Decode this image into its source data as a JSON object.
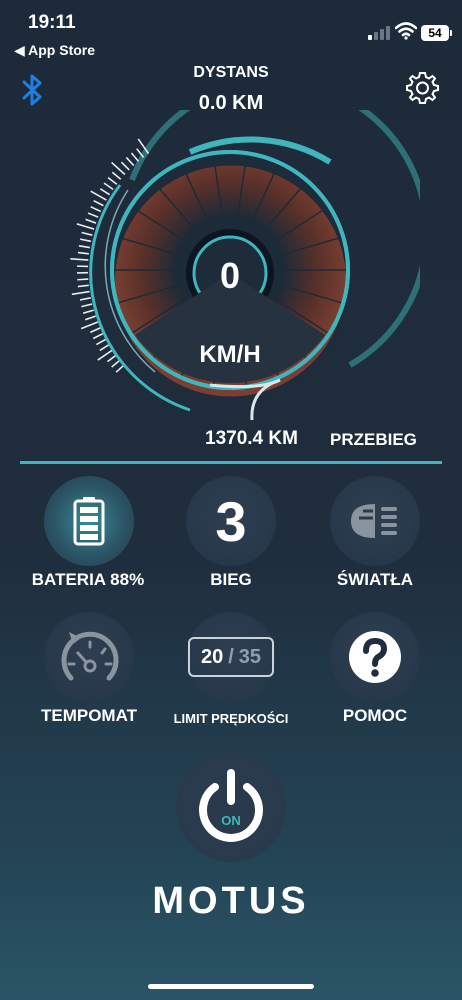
{
  "status_bar": {
    "time": "19:11",
    "back_label": "◀ App Store",
    "battery": "54"
  },
  "header": {
    "distance_label": "DYSTANS",
    "distance_value": "0.0 KM"
  },
  "speedometer": {
    "speed": "0",
    "unit": "KM/H"
  },
  "odometer": {
    "value": "1370.4 KM",
    "label": "PRZEBIEG"
  },
  "controls": {
    "battery_label": "BATERIA  88%",
    "battery_level": 88,
    "gear_value": "3",
    "gear_label": "BIEG",
    "lights_label": "ŚWIATŁA",
    "cruise_label": "TEMPOMAT",
    "limit_current": "20",
    "limit_sep": "/",
    "limit_max": "35",
    "limit_label": "LIMIT PRĘDKOŚCI",
    "help_label": "POMOC",
    "power_label": "ON"
  },
  "brand": "MOTUS",
  "colors": {
    "accent": "#3fb6bd",
    "blue": "#1e7fe0",
    "segment": "#7a3f32"
  },
  "icons": [
    "bluetooth-icon",
    "gear-icon",
    "battery-icon",
    "headlight-icon",
    "cruise-control-icon",
    "help-icon",
    "power-icon"
  ]
}
